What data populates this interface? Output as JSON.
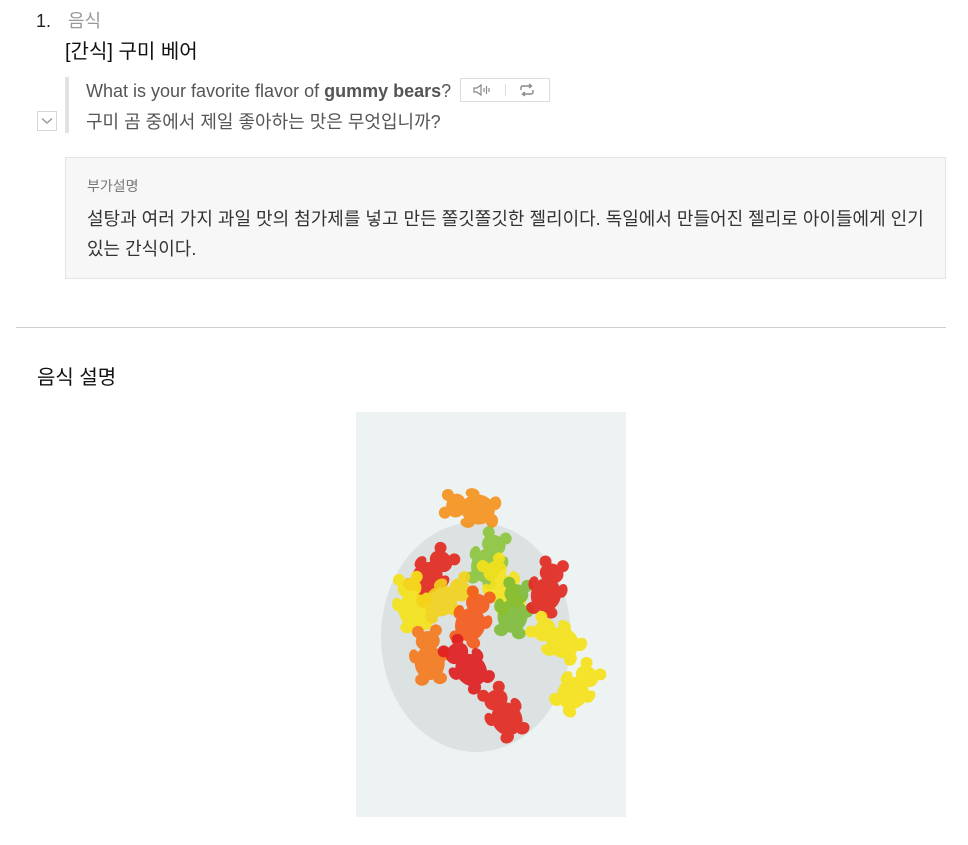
{
  "entry": {
    "number": "1.",
    "category": "음식",
    "headword": "[간식] 구미 베어"
  },
  "example": {
    "en_before": "What is your favorite flavor of ",
    "en_bold": "gummy bears",
    "en_after": "?",
    "ko": "구미 곰 중에서 제일 좋아하는 맛은 무엇입니까?",
    "icons": [
      "speaker-icon",
      "repeat-icon",
      "chevron-down-icon"
    ]
  },
  "note": {
    "label": "부가설명",
    "text": "설탕과 여러 가지 과일 맛의 첨가제를 넣고 만든 쫄깃쫄깃한 젤리이다. 독일에서 만들어진 젤리로 아이들에게 인기 있는 간식이다."
  },
  "section": {
    "title": "음식 설명"
  },
  "photo": {
    "subject": "gummy bears",
    "colors": [
      "#f5931e",
      "#e22a22",
      "#f6e21b",
      "#8cc63e",
      "#f45c1c"
    ]
  }
}
